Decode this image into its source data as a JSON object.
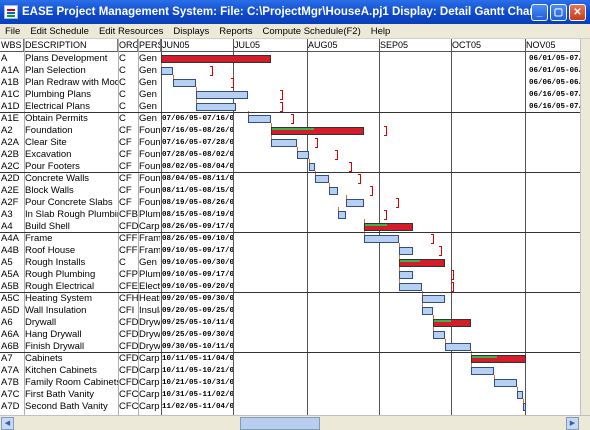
{
  "window": {
    "title": "EASE Project Management System:  File:  C:\\ProjectMgr\\HouseA.pj1  Display: Detail Gantt Chart",
    "buttons": [
      "_",
      "▢",
      "✕"
    ]
  },
  "menu": [
    "File",
    "Edit Schedule",
    "Edit Resources",
    "Displays",
    "Reports",
    "Compute Schedule(F2)",
    "Help"
  ],
  "columns": {
    "wbs": "WBS",
    "description": "DESCRIPTION",
    "org": "ORG",
    "pers": "PERS",
    "months": [
      "JUN05",
      "JUL05",
      "AUG05",
      "SEP05",
      "OCT05",
      "NOV05"
    ]
  },
  "rows": [
    {
      "wbs": "A",
      "desc": "Plans Development",
      "org": "C",
      "pers": "Gen C",
      "dates": "06/01/05-07/16/05",
      "dates_side": "right",
      "bar": {
        "start": 0.0,
        "end": 0.38,
        "type": "crit"
      },
      "float_end": null
    },
    {
      "wbs": "A1A",
      "desc": "Plan Selection",
      "org": "C",
      "pers": "Gen C",
      "dates": "06/01/05-06/06/05",
      "dates_side": "right",
      "bar": {
        "start": 0.0,
        "end": 0.04,
        "type": "norm"
      },
      "float_end": 0.17
    },
    {
      "wbs": "A1B",
      "desc": "Plan Redraw with Modificat",
      "org": "C",
      "pers": "Gen C",
      "dates": "06/06/05-06/16/05",
      "dates_side": "right",
      "bar": {
        "start": 0.04,
        "end": 0.12,
        "type": "norm"
      },
      "float_end": 0.24
    },
    {
      "wbs": "A1C",
      "desc": "Plumbing Plans",
      "org": "C",
      "pers": "Gen C",
      "dates": "06/16/05-07/06/05",
      "dates_side": "right",
      "bar": {
        "start": 0.12,
        "end": 0.3,
        "type": "norm"
      },
      "float_end": 0.41
    },
    {
      "wbs": "A1D",
      "desc": "Electrical Plans",
      "org": "C",
      "pers": "Gen C",
      "dates": "06/16/05-07/01/05",
      "dates_side": "right",
      "bar": {
        "start": 0.12,
        "end": 0.26,
        "type": "norm"
      },
      "float_end": 0.41
    },
    {
      "wbs": "A1E",
      "desc": "Obtain Permits",
      "org": "C",
      "pers": "Gen C",
      "dates": "07/06/05-07/16/05",
      "dates_side": "left",
      "bar": {
        "start": 0.3,
        "end": 0.38,
        "type": "norm"
      },
      "float_end": 0.45
    },
    {
      "wbs": "A2",
      "desc": "Foundation",
      "org": "CF",
      "pers": "Found",
      "dates": "07/16/05-08/26/05",
      "dates_side": "left",
      "bar": {
        "start": 0.38,
        "end": 0.7,
        "type": "crit"
      },
      "float_end": 0.77
    },
    {
      "wbs": "A2A",
      "desc": "Clear Site",
      "org": "CF",
      "pers": "Found",
      "dates": "07/16/05-07/28/05",
      "dates_side": "left",
      "bar": {
        "start": 0.38,
        "end": 0.47,
        "type": "norm"
      },
      "float_end": 0.53
    },
    {
      "wbs": "A2B",
      "desc": "Excavation",
      "org": "CF",
      "pers": "Found",
      "dates": "07/28/05-08/02/05",
      "dates_side": "left",
      "bar": {
        "start": 0.47,
        "end": 0.51,
        "type": "norm"
      },
      "float_end": 0.6
    },
    {
      "wbs": "A2C",
      "desc": "Pour Footers",
      "org": "CF",
      "pers": "Found",
      "dates": "08/02/05-08/04/05",
      "dates_side": "left",
      "bar": {
        "start": 0.51,
        "end": 0.53,
        "type": "norm"
      },
      "float_end": 0.65
    },
    {
      "wbs": "A2D",
      "desc": "Concrete Walls",
      "org": "CF",
      "pers": "Found",
      "dates": "08/04/05-08/11/05",
      "dates_side": "left",
      "bar": {
        "start": 0.53,
        "end": 0.58,
        "type": "norm"
      },
      "float_end": 0.68
    },
    {
      "wbs": "A2E",
      "desc": "Block Walls",
      "org": "CF",
      "pers": "Found",
      "dates": "08/11/05-08/15/05",
      "dates_side": "left",
      "bar": {
        "start": 0.58,
        "end": 0.61,
        "type": "norm"
      },
      "float_end": 0.72
    },
    {
      "wbs": "A2F",
      "desc": "Pour Concrete Slabs",
      "org": "CF",
      "pers": "Found",
      "dates": "08/19/05-08/26/05",
      "dates_side": "left",
      "bar": {
        "start": 0.64,
        "end": 0.7,
        "type": "norm"
      },
      "float_end": 0.81
    },
    {
      "wbs": "A3",
      "desc": "In Slab Rough Plumbing",
      "org": "CFB",
      "pers": "Plumb",
      "dates": "08/15/05-08/19/05",
      "dates_side": "left",
      "bar": {
        "start": 0.61,
        "end": 0.64,
        "type": "norm"
      },
      "float_end": 0.77
    },
    {
      "wbs": "A4",
      "desc": "Build Shell",
      "org": "CFD",
      "pers": "Carpe",
      "dates": "08/26/05-09/17/05",
      "dates_side": "left",
      "bar": {
        "start": 0.7,
        "end": 0.87,
        "type": "crit"
      },
      "float_end": null
    },
    {
      "wbs": "A4A",
      "desc": "Frame",
      "org": "CFF",
      "pers": "Frame",
      "dates": "08/26/05-09/10/05",
      "dates_side": "left",
      "bar": {
        "start": 0.7,
        "end": 0.82,
        "type": "norm"
      },
      "float_end": 0.93
    },
    {
      "wbs": "A4B",
      "desc": "Roof House",
      "org": "CFF",
      "pers": "Frame",
      "dates": "09/10/05-09/17/05",
      "dates_side": "left",
      "bar": {
        "start": 0.82,
        "end": 0.87,
        "type": "norm"
      },
      "float_end": 0.96
    },
    {
      "wbs": "A5",
      "desc": "Rough Installs",
      "org": "C",
      "pers": "Gen C",
      "dates": "09/10/05-09/30/05",
      "dates_side": "left",
      "bar": {
        "start": 0.82,
        "end": 0.98,
        "type": "crit"
      },
      "float_end": null
    },
    {
      "wbs": "A5A",
      "desc": "Rough Plumbing",
      "org": "CFP",
      "pers": "Plumb",
      "dates": "09/10/05-09/17/05",
      "dates_side": "left",
      "bar": {
        "start": 0.82,
        "end": 0.87,
        "type": "norm"
      },
      "float_end": 1.0
    },
    {
      "wbs": "A5B",
      "desc": "Rough Electrical",
      "org": "CFE",
      "pers": "Electr",
      "dates": "09/10/05-09/20/05",
      "dates_side": "left",
      "bar": {
        "start": 0.82,
        "end": 0.9,
        "type": "norm"
      },
      "float_end": 1.0
    },
    {
      "wbs": "A5C",
      "desc": "Heating System",
      "org": "CFH",
      "pers": "Heatin",
      "dates": "09/20/05-09/30/05",
      "dates_side": "left",
      "bar": {
        "start": 0.9,
        "end": 0.98,
        "type": "norm"
      },
      "float_end": null
    },
    {
      "wbs": "A5D",
      "desc": "Wall Insulation",
      "org": "CFI",
      "pers": "Insula",
      "dates": "09/20/05-09/25/05",
      "dates_side": "left",
      "bar": {
        "start": 0.9,
        "end": 0.94,
        "type": "norm"
      },
      "float_end": null
    },
    {
      "wbs": "A6",
      "desc": "Drywall",
      "org": "CFD",
      "pers": "Drywa",
      "dates": "09/25/05-10/11/05",
      "dates_side": "left",
      "bar": {
        "start": 0.94,
        "end": 1.07,
        "type": "crit"
      },
      "float_end": null
    },
    {
      "wbs": "A6A",
      "desc": "Hang Drywall",
      "org": "CFD",
      "pers": "Drywa",
      "dates": "09/25/05-09/30/05",
      "dates_side": "left",
      "bar": {
        "start": 0.94,
        "end": 0.98,
        "type": "norm"
      },
      "float_end": null
    },
    {
      "wbs": "A6B",
      "desc": "Finish Drywall",
      "org": "CFD",
      "pers": "Drywa",
      "dates": "09/30/05-10/11/05",
      "dates_side": "left",
      "bar": {
        "start": 0.98,
        "end": 1.07,
        "type": "norm"
      },
      "float_end": null
    },
    {
      "wbs": "A7",
      "desc": "Cabinets",
      "org": "CFD",
      "pers": "Carpe",
      "dates": "10/11/05-11/04/05",
      "dates_side": "left",
      "bar": {
        "start": 1.07,
        "end": 1.26,
        "type": "crit"
      },
      "float_end": null
    },
    {
      "wbs": "A7A",
      "desc": "Kitchen Cabinets",
      "org": "CFD",
      "pers": "Carpe",
      "dates": "10/11/05-10/21/05",
      "dates_side": "left",
      "bar": {
        "start": 1.07,
        "end": 1.15,
        "type": "norm"
      },
      "float_end": null
    },
    {
      "wbs": "A7B",
      "desc": "Family Room Cabinets",
      "org": "CFD",
      "pers": "Carpe",
      "dates": "10/21/05-10/31/05",
      "dates_side": "left",
      "bar": {
        "start": 1.15,
        "end": 1.23,
        "type": "norm"
      },
      "float_end": null
    },
    {
      "wbs": "A7C",
      "desc": "First Bath Vanity",
      "org": "CFC",
      "pers": "Carpe",
      "dates": "10/31/05-11/02/05",
      "dates_side": "left",
      "bar": {
        "start": 1.23,
        "end": 1.25,
        "type": "norm"
      },
      "float_end": null
    },
    {
      "wbs": "A7D",
      "desc": "Second Bath Vanity",
      "org": "CFC",
      "pers": "Carpe",
      "dates": "11/02/05-11/04/05",
      "dates_side": "left",
      "bar": {
        "start": 1.25,
        "end": 1.26,
        "type": "norm"
      },
      "float_end": null
    }
  ],
  "colors": {
    "critical": "#d41c2a",
    "normal": "#b7cff0",
    "float": "#dd0000",
    "link": "#e0701a"
  }
}
